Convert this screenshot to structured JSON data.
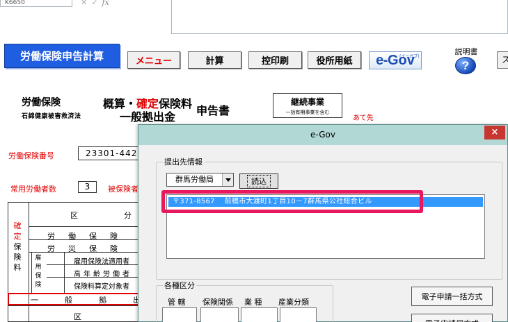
{
  "formula_bar": {
    "cell_ref": "K6650",
    "fx_label": "fx"
  },
  "toolbar": {
    "title_label": "労働保険申告計算",
    "menu_label": "メニュー",
    "calc_label": "計算",
    "hikae_label": "控印刷",
    "yakusho_label": "役所用紙",
    "egov_logo_e": "e-",
    "egov_logo_gov": "Gov",
    "egov_logo_sub": "(イーガブ)",
    "manual_label": "説明書",
    "help_icon": "question-icon",
    "edge_label": "ス"
  },
  "form": {
    "title_roudou": "労働保険",
    "title_sekimen": "石綿健康被害救済法",
    "title_gaisan_black1": "概算・",
    "title_gaisan_red": "確定",
    "title_gaisan_black2": "保険料",
    "title_ippan": "一般拠出金",
    "title_shinkoku": "申告書",
    "keizoku_main": "継続事業",
    "keizoku_sub": "一括有期事業を含む",
    "atesaki": "あて先",
    "hoken_number_label": "労働保険番号",
    "hoken_number_value": "23301-442",
    "jouyou_label": "常用労働者数",
    "jouyou_value": "3",
    "hihoken_label": "被保険者"
  },
  "table": {
    "kubun": "区",
    "bun": "分",
    "vertical_red": [
      "確",
      "定"
    ],
    "vertical_black": [
      "保",
      "険",
      "料"
    ],
    "vertical_koyou": [
      "雇",
      "用",
      "保",
      "険"
    ],
    "row1": "労働保険",
    "row2": "労災保険",
    "row3": "雇用保険法適用者",
    "row4": "高年齢労働者",
    "row5": "保険料算定対象者",
    "row6": "一般拠出",
    "row7": "区"
  },
  "dialog": {
    "title": "e-Gov",
    "close_label": "×",
    "group1_legend": "提出先情報",
    "office_selected": "群馬労働局",
    "load_button": "読込",
    "list_items": [
      "〒371-8567　 前橋市大渡町1丁目10－7群馬県公社総合ビル"
    ],
    "group2_legend": "各種区分",
    "col_kankatsu": "管 轄",
    "col_hoken": "保険関係",
    "col_gyoushu": "業 種",
    "col_sangyou": "産業分類",
    "bulk_button": "電子申請一括方式",
    "individual_button": "電子申請個方式"
  },
  "colors": {
    "title_button_bg": "#1f5ee0",
    "accent_red": "#e00000",
    "dialog_titlebar": "#b2d8d5",
    "close_button": "#c7372f",
    "selection": "#3399ff",
    "highlight_frame": "#e8185e"
  }
}
